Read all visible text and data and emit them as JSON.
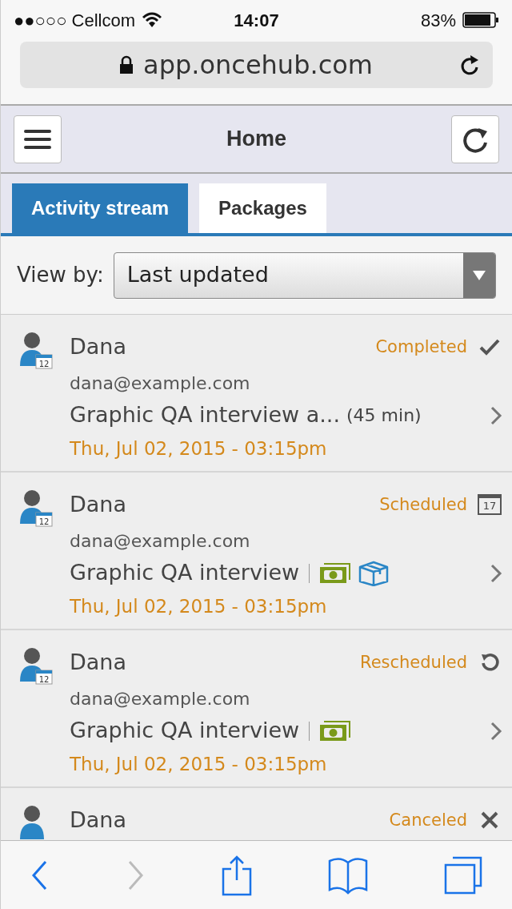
{
  "status_bar": {
    "carrier": "●●○○○ Cellcom",
    "time": "14:07",
    "battery": "83%"
  },
  "address_bar": {
    "url": "app.oncehub.com"
  },
  "header": {
    "title": "Home"
  },
  "tabs": [
    {
      "label": "Activity stream",
      "selected": true
    },
    {
      "label": "Packages",
      "selected": false
    }
  ],
  "view_by": {
    "label": "View by:",
    "value": "Last updated"
  },
  "activities": [
    {
      "name": "Dana",
      "avatar_badge": "12",
      "status": "Completed",
      "kind": "completed",
      "email": "dana@example.com",
      "title": "Graphic QA interview a...",
      "duration": "(45 min)",
      "date": "Thu, Jul 02, 2015 - 03:15pm"
    },
    {
      "name": "Dana",
      "avatar_badge": "12",
      "status": "Scheduled",
      "kind": "scheduled",
      "status_icon_label": "17",
      "email": "dana@example.com",
      "title": "Graphic QA interview",
      "extras": [
        {
          "kind": "payment"
        },
        {
          "kind": "package"
        }
      ],
      "date": "Thu, Jul 02, 2015 - 03:15pm"
    },
    {
      "name": "Dana",
      "avatar_badge": "12",
      "status": "Rescheduled",
      "kind": "rescheduled",
      "email": "dana@example.com",
      "title": "Graphic QA interview",
      "extras": [
        {
          "kind": "payment"
        }
      ],
      "date": "Thu, Jul 02, 2015 - 03:15pm"
    },
    {
      "name": "Dana",
      "status": "Canceled",
      "kind": "canceled"
    }
  ],
  "toolbar": [
    {
      "kind": "back",
      "disabled": false
    },
    {
      "kind": "forward",
      "disabled": true
    },
    {
      "kind": "share",
      "disabled": false
    },
    {
      "kind": "bookmarks",
      "disabled": false
    },
    {
      "kind": "tabs",
      "disabled": false
    }
  ]
}
